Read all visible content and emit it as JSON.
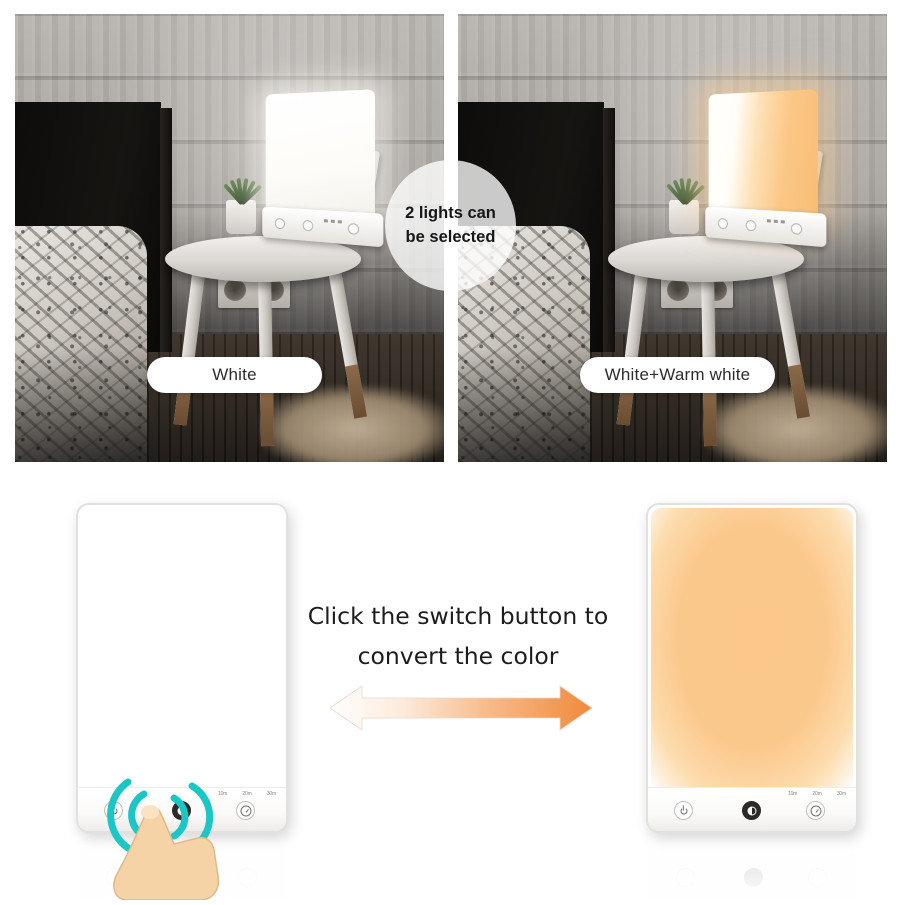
{
  "photos": {
    "left": {
      "name": "bedroom-scene-white-light",
      "caption": "White",
      "lamp_mode": "white"
    },
    "right": {
      "name": "bedroom-scene-warm-white-light",
      "caption": "White+Warm white",
      "lamp_mode": "white-warm-white"
    }
  },
  "badge": {
    "line1": "2 lights can",
    "line2": "be selected"
  },
  "instruction": {
    "line1": "Click the switch button to",
    "line2": "convert the color"
  },
  "lamps": {
    "left": {
      "label": "white-light-lamp",
      "glow_color": "#ffffff",
      "timer_ticks": [
        "10m",
        "20m",
        "30m"
      ],
      "buttons": [
        "power",
        "brightness",
        "timer"
      ]
    },
    "right": {
      "label": "warm-white-light-lamp",
      "glow_color": "#fbc78a",
      "timer_ticks": [
        "10m",
        "20m",
        "30m"
      ],
      "buttons": [
        "power",
        "brightness",
        "timer"
      ]
    }
  },
  "colors": {
    "warm_white": "#fbc78a",
    "arrow_end": "#f08a3c",
    "ripple": "#1bc6c6",
    "skin": "#f5d3a6",
    "pill_bg": "#ffffff",
    "text": "#1d1d1f"
  },
  "icons": {
    "power": "power-icon",
    "brightness": "brightness-moon-icon",
    "timer": "timer-dial-icon",
    "hand": "pointing-hand-icon",
    "ripple": "tap-ripple-icon",
    "arrow": "double-arrow-icon"
  }
}
